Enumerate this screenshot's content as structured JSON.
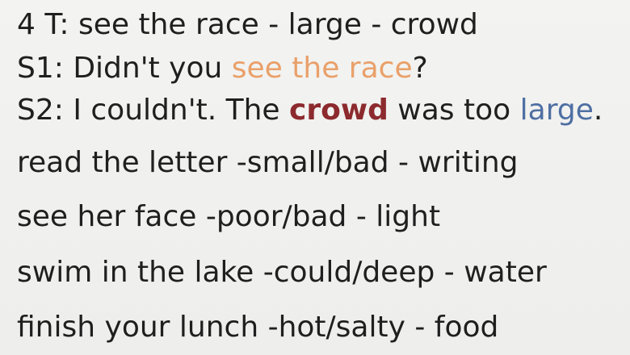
{
  "slide": {
    "line1": "4 T: see the race - large - crowd",
    "line2": {
      "before": "S1: Didn't you ",
      "highlight": "see the race",
      "after": "?"
    },
    "line3": {
      "part1": "S2: I couldn't. The ",
      "crowd": "crowd",
      "part2": " was too ",
      "large": "large",
      "part3": "."
    },
    "prompts": [
      "read the letter -small/bad - writing",
      "see her face -poor/bad - light",
      "swim in the lake -could/deep - water",
      "finish your lunch -hot/salty - food"
    ]
  },
  "colors": {
    "orange": "#e9a06a",
    "red": "#8c2a2e",
    "blue": "#4e6fa3",
    "text": "#1f1f1f"
  }
}
